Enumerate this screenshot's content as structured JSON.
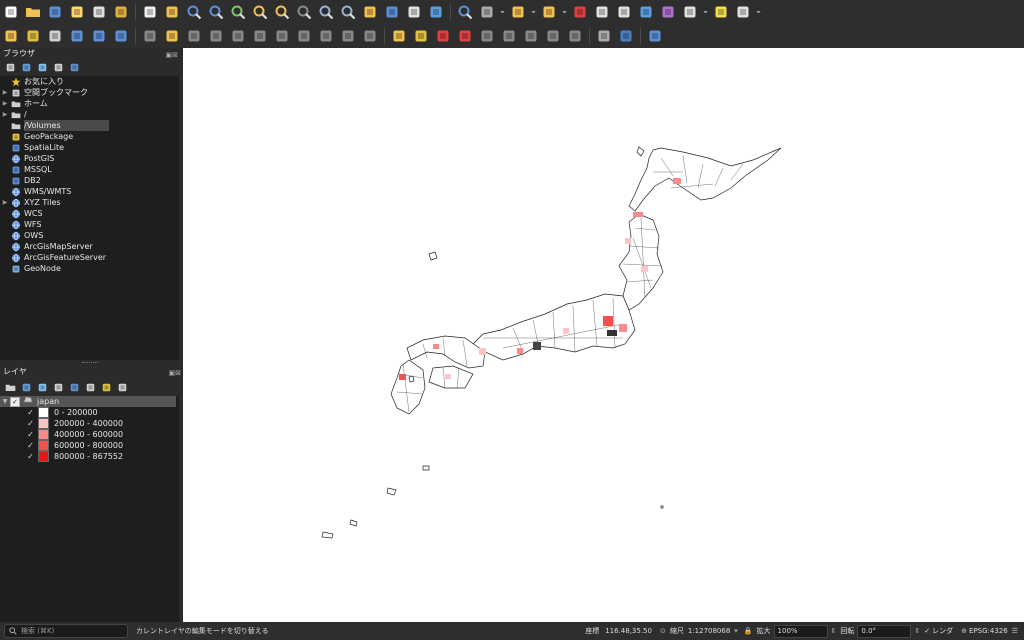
{
  "toolbar_row1": [
    {
      "name": "new-project-icon",
      "color": "#ffffff"
    },
    {
      "name": "open-project-icon",
      "color": "#f0c050"
    },
    {
      "name": "save-project-icon",
      "color": "#5d8fd6"
    },
    {
      "name": "save-as-icon",
      "color": "#ffd66b"
    },
    {
      "name": "print-layout-icon",
      "color": "#e0e0e0"
    },
    {
      "name": "style-manager-icon",
      "color": "#e0b040"
    },
    {
      "name": "sep"
    },
    {
      "name": "pan-map-icon",
      "color": "#f0f0f0"
    },
    {
      "name": "pan-to-selection-icon",
      "color": "#f0c050"
    },
    {
      "name": "zoom-in-icon",
      "color": "#5d8fd6"
    },
    {
      "name": "zoom-out-icon",
      "color": "#5d8fd6"
    },
    {
      "name": "zoom-full-icon",
      "color": "#7cc46b"
    },
    {
      "name": "zoom-to-selection-icon",
      "color": "#f0c050"
    },
    {
      "name": "zoom-to-layer-icon",
      "color": "#f0c050"
    },
    {
      "name": "zoom-native-icon",
      "color": "#888888"
    },
    {
      "name": "zoom-last-icon",
      "color": "#9ab0d0"
    },
    {
      "name": "zoom-next-icon",
      "color": "#9ab0d0"
    },
    {
      "name": "new-map-view-icon",
      "color": "#f0c050"
    },
    {
      "name": "temporal-controller-icon",
      "color": "#5d8fd6"
    },
    {
      "name": "bookmark-icon",
      "color": "#e0e0e0"
    },
    {
      "name": "refresh-icon",
      "color": "#5d9ee0"
    },
    {
      "name": "sep"
    },
    {
      "name": "identify-icon",
      "color": "#5d8fd6"
    },
    {
      "name": "actions-icon",
      "color": "#aaaaaa"
    },
    {
      "name": "dropdown-arrow-icon",
      "color": "#aaaaaa"
    },
    {
      "name": "select-features-icon",
      "color": "#f0c050"
    },
    {
      "name": "dropdown-arrow-icon",
      "color": "#aaaaaa"
    },
    {
      "name": "select-by-value-icon",
      "color": "#f0c050"
    },
    {
      "name": "dropdown-arrow-icon",
      "color": "#aaaaaa"
    },
    {
      "name": "deselect-icon",
      "color": "#e04040"
    },
    {
      "name": "attribute-table-icon",
      "color": "#e0e0e0"
    },
    {
      "name": "field-calculator-icon",
      "color": "#e0e0e0"
    },
    {
      "name": "processing-toolbox-icon",
      "color": "#5d9ee0"
    },
    {
      "name": "statistics-icon",
      "color": "#b070d0"
    },
    {
      "name": "measure-icon",
      "color": "#e0e0e0"
    },
    {
      "name": "dropdown-arrow-icon",
      "color": "#aaaaaa"
    },
    {
      "name": "map-tips-icon",
      "color": "#f0e050"
    },
    {
      "name": "text-annotation-icon",
      "color": "#e0e0e0"
    },
    {
      "name": "dropdown-arrow-icon",
      "color": "#aaaaaa"
    }
  ],
  "toolbar_row2": [
    {
      "name": "data-source-manager-icon",
      "color": "#f0c050"
    },
    {
      "name": "new-geopackage-layer-icon",
      "color": "#e0c040"
    },
    {
      "name": "new-shapefile-icon",
      "color": "#d0d0d0"
    },
    {
      "name": "new-spatialite-icon",
      "color": "#5d8fd6"
    },
    {
      "name": "new-temp-layer-icon",
      "color": "#5d8fd6"
    },
    {
      "name": "new-virtual-layer-icon",
      "color": "#5d8fd6"
    },
    {
      "name": "sep"
    },
    {
      "name": "current-edits-icon",
      "color": "#888888"
    },
    {
      "name": "toggle-editing-icon",
      "color": "#f0c050"
    },
    {
      "name": "save-edits-icon",
      "color": "#888888"
    },
    {
      "name": "digitize-icon",
      "color": "#888888"
    },
    {
      "name": "vertex-tool-icon",
      "color": "#888888"
    },
    {
      "name": "delete-selected-icon",
      "color": "#888888"
    },
    {
      "name": "cut-features-icon",
      "color": "#888888"
    },
    {
      "name": "copy-features-icon",
      "color": "#888888"
    },
    {
      "name": "paste-features-icon",
      "color": "#888888"
    },
    {
      "name": "undo-icon",
      "color": "#888888"
    },
    {
      "name": "redo-icon",
      "color": "#888888"
    },
    {
      "name": "sep"
    },
    {
      "name": "label-toolbar-icon",
      "color": "#f0c050"
    },
    {
      "name": "label-rules-icon",
      "color": "#e0c040"
    },
    {
      "name": "label-pin-icon",
      "color": "#e04040"
    },
    {
      "name": "label-diagram-icon",
      "color": "#e04040"
    },
    {
      "name": "label-move-icon",
      "color": "#888888"
    },
    {
      "name": "label-rotate-icon",
      "color": "#888888"
    },
    {
      "name": "label-change-icon",
      "color": "#888888"
    },
    {
      "name": "label-show-hide-icon",
      "color": "#888888"
    },
    {
      "name": "label-pin-all-icon",
      "color": "#888888"
    },
    {
      "name": "sep"
    },
    {
      "name": "georeferencer-icon",
      "color": "#aaaaaa"
    },
    {
      "name": "python-console-icon",
      "color": "#4a80c0"
    },
    {
      "name": "sep"
    },
    {
      "name": "help-icon",
      "color": "#5d8fd6"
    }
  ],
  "browser": {
    "title": "ブラウザ",
    "tools": [
      "add-layer-icon",
      "refresh-icon",
      "filter-icon",
      "collapse-all-icon",
      "info-icon"
    ],
    "items": [
      {
        "label": "お気に入り",
        "icon": "star-icon",
        "color": "#f0c030",
        "expandable": false
      },
      {
        "label": "空間ブックマーク",
        "icon": "bookmark-icon",
        "color": "#d0d0d0",
        "expandable": true
      },
      {
        "label": "ホーム",
        "icon": "home-folder-icon",
        "color": "#d0d0d0",
        "expandable": true
      },
      {
        "label": "/",
        "icon": "folder-icon",
        "color": "#d0d0d0",
        "expandable": true
      },
      {
        "label": "/Volumes",
        "icon": "folder-icon",
        "color": "#d0d0d0",
        "expandable": false,
        "selected": true
      },
      {
        "label": "GeoPackage",
        "icon": "geopackage-icon",
        "color": "#e0c040",
        "expandable": false
      },
      {
        "label": "SpatiaLite",
        "icon": "spatialite-icon",
        "color": "#5d8fd6",
        "expandable": false
      },
      {
        "label": "PostGIS",
        "icon": "postgis-icon",
        "color": "#5d8fd6",
        "expandable": false
      },
      {
        "label": "MSSQL",
        "icon": "mssql-icon",
        "color": "#5d8fd6",
        "expandable": false
      },
      {
        "label": "DB2",
        "icon": "db2-icon",
        "color": "#5d8fd6",
        "expandable": false
      },
      {
        "label": "WMS/WMTS",
        "icon": "globe-icon",
        "color": "#5d8fd6",
        "expandable": false
      },
      {
        "label": "XYZ Tiles",
        "icon": "globe-icon",
        "color": "#5d8fd6",
        "expandable": true
      },
      {
        "label": "WCS",
        "icon": "globe-icon",
        "color": "#5d8fd6",
        "expandable": false
      },
      {
        "label": "WFS",
        "icon": "globe-icon",
        "color": "#5d8fd6",
        "expandable": false
      },
      {
        "label": "OWS",
        "icon": "globe-icon",
        "color": "#5d8fd6",
        "expandable": false
      },
      {
        "label": "ArcGisMapServer",
        "icon": "arcgis-icon",
        "color": "#5d8fd6",
        "expandable": false
      },
      {
        "label": "ArcGisFeatureServer",
        "icon": "arcgis-icon",
        "color": "#5d8fd6",
        "expandable": false
      },
      {
        "label": "GeoNode",
        "icon": "geonode-icon",
        "color": "#7ab0e0",
        "expandable": false
      }
    ]
  },
  "layers": {
    "title": "レイヤ",
    "tools": [
      "open-styling-icon",
      "add-group-icon",
      "manage-themes-icon",
      "filter-legend-icon",
      "filter-dropdown-icon",
      "expand-all-icon",
      "collapse-all-icon",
      "remove-layer-icon"
    ],
    "layer_name": "japan",
    "classes": [
      {
        "label": "0 - 200000",
        "color": "#ffffff"
      },
      {
        "label": "200000 - 400000",
        "color": "#fcc5c5"
      },
      {
        "label": "400000 - 600000",
        "color": "#f88a8a"
      },
      {
        "label": "600000 - 800000",
        "color": "#f45050"
      },
      {
        "label": "800000 - 867552",
        "color": "#f01414"
      }
    ]
  },
  "status": {
    "search_placeholder": "検索 (⌘K)",
    "message": "カレントレイヤの編集モードを切り替える",
    "coord_label": "座標",
    "coord_value": "116.48,35.50",
    "scale_label": "縮尺",
    "scale_value": "1:12708068",
    "magnify_label": "拡大",
    "magnify_value": "100%",
    "rotation_label": "回転",
    "rotation_value": "0.0°",
    "render_label": "レンダ",
    "crs_label": "EPSG:4326"
  }
}
